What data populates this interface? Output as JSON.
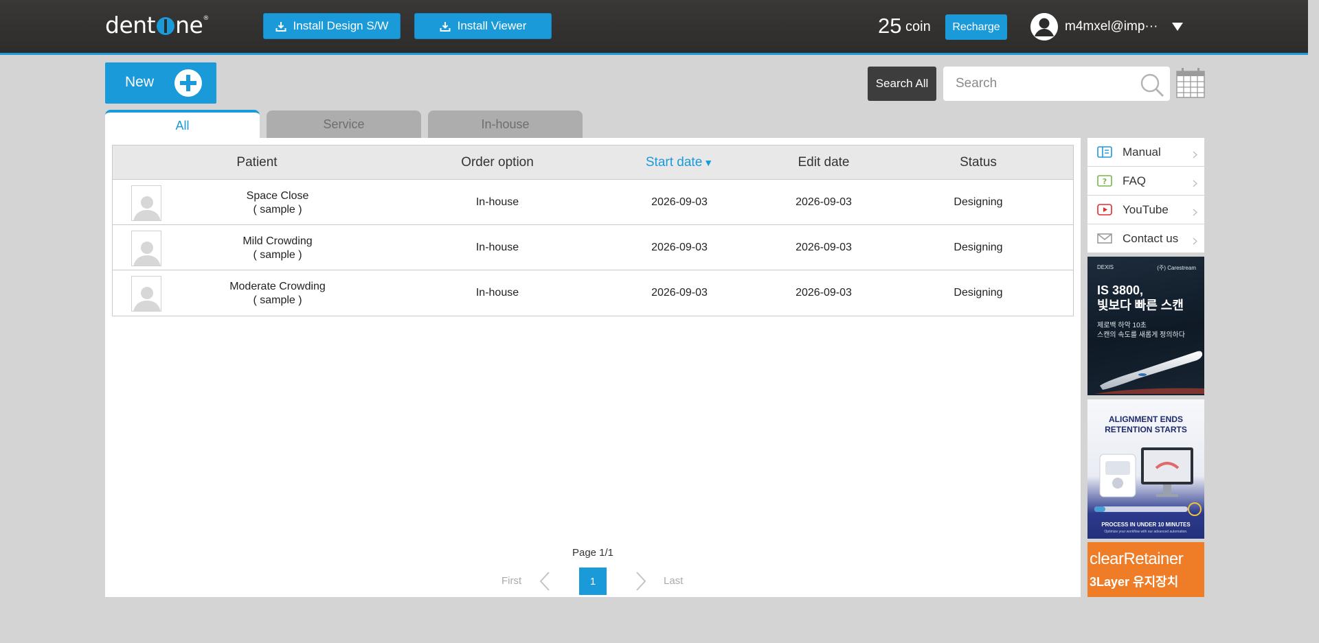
{
  "header": {
    "logo_text_left": "dent",
    "logo_text_right": "ne",
    "install_design_label": "Install Design S/W",
    "install_viewer_label": "Install Viewer",
    "coin_amount": "25",
    "coin_label": "coin",
    "recharge_label": "Recharge",
    "user_email": "m4mxel@imp···"
  },
  "toolbar": {
    "new_label": "New",
    "search_all_label": "Search All",
    "search_placeholder": "Search"
  },
  "tabs": [
    {
      "label": "All",
      "active": true
    },
    {
      "label": "Service",
      "active": false
    },
    {
      "label": "In-house",
      "active": false
    }
  ],
  "table": {
    "columns": [
      "Patient",
      "Order option",
      "Start date",
      "Edit date",
      "Status"
    ],
    "sort_column": "Start date",
    "sort_indicator": "▼",
    "rows": [
      {
        "name": "Space Close",
        "note": "( sample )",
        "order_option": "In-house",
        "start_date": "2026-09-03",
        "edit_date": "2026-09-03",
        "status": "Designing"
      },
      {
        "name": "Mild Crowding",
        "note": "( sample )",
        "order_option": "In-house",
        "start_date": "2026-09-03",
        "edit_date": "2026-09-03",
        "status": "Designing"
      },
      {
        "name": "Moderate Crowding",
        "note": "( sample )",
        "order_option": "In-house",
        "start_date": "2026-09-03",
        "edit_date": "2026-09-03",
        "status": "Designing"
      }
    ]
  },
  "pagination": {
    "page_label": "Page 1/1",
    "first_label": "First",
    "current_page": "1",
    "last_label": "Last"
  },
  "sidebar": {
    "links": [
      {
        "label": "Manual",
        "icon": "book-icon",
        "color": "#1a9ad8"
      },
      {
        "label": "FAQ",
        "icon": "question-icon",
        "color": "#7ab648"
      },
      {
        "label": "YouTube",
        "icon": "youtube-icon",
        "color": "#e02b2b"
      },
      {
        "label": "Contact us",
        "icon": "mail-icon",
        "color": "#9a9a9a"
      }
    ],
    "ads": {
      "ad1": {
        "brand_left": "DEXIS",
        "brand_right": "(주) Carestream",
        "headline_1": "IS 3800,",
        "headline_2": "빛보다 빠른 스캔",
        "sub_1": "제로백 하악 10초",
        "sub_2": "스캔의 속도를 새롭게 정의하다"
      },
      "ad2": {
        "headline_1": "ALIGNMENT ENDS",
        "headline_2": "RETENTION STARTS",
        "footer_1": "PROCESS IN UNDER 10 MINUTES",
        "footer_2": "Optimize your workflow with our advanced automation."
      },
      "ad3": {
        "line_1": "clearRetainer",
        "line_2": "3Layer 유지장치"
      }
    }
  },
  "colors": {
    "accent": "#1a9ad8",
    "header_bg": "#2e2c2a",
    "page_bg": "#d4d4d4"
  }
}
